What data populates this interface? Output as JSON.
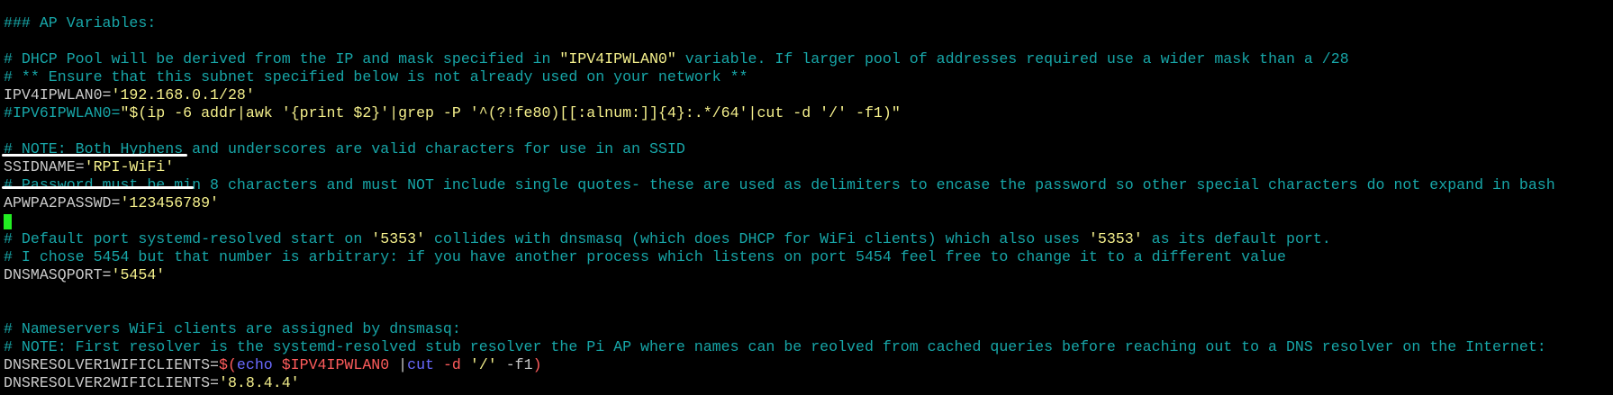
{
  "terminal": {
    "lines": [
      [
        {
          "t": "### AP Variables:",
          "c": "c"
        }
      ],
      [],
      [
        {
          "t": "# DHCP Pool will be derived from the IP and mask specified in ",
          "c": "c"
        },
        {
          "t": "\"IPV4IPWLAN0\"",
          "c": "y"
        },
        {
          "t": " variable. If larger pool of addresses required use a wider mask than a /28",
          "c": "c"
        }
      ],
      [
        {
          "t": "# ** Ensure that this subnet specified below is not already used on your network **",
          "c": "c"
        }
      ],
      [
        {
          "t": "IPV4IPWLAN0=",
          "c": "w"
        },
        {
          "t": "'192.168.0.1/28'",
          "c": "y"
        }
      ],
      [
        {
          "t": "#IPV6IPWLAN0=",
          "c": "c"
        },
        {
          "t": "\"$(ip -6 addr|awk '{print $2}'|grep -P '^(?!fe80)[[:alnum:]]{4}:.*/64'|cut -d '/' -f1)\"",
          "c": "y"
        }
      ],
      [],
      [
        {
          "t": "# NOTE: Both Hyphens and underscores are valid characters for use in an SSID",
          "c": "c"
        }
      ],
      [
        {
          "t": "SSIDNAME=",
          "c": "w"
        },
        {
          "t": "'RPI-WiFi'",
          "c": "y"
        }
      ],
      [
        {
          "t": "# Password must be min 8 characters and must NOT include single quotes- these are used as delimiters to encase the password so other special characters do not expand in bash",
          "c": "c"
        }
      ],
      [
        {
          "t": "APWPA2PASSWD=",
          "c": "w"
        },
        {
          "t": "'123456789'",
          "c": "y"
        }
      ],
      [],
      [
        {
          "t": "# Default port systemd-resolved start on ",
          "c": "c"
        },
        {
          "t": "'5353'",
          "c": "y"
        },
        {
          "t": " collides with dnsmasq (which does DHCP for WiFi clients) which also uses ",
          "c": "c"
        },
        {
          "t": "'5353'",
          "c": "y"
        },
        {
          "t": " as its default port.",
          "c": "c"
        }
      ],
      [
        {
          "t": "# I chose 5454 but that number is arbitrary: if you have another process which listens on port 5454 feel free to change it to a different value",
          "c": "c"
        }
      ],
      [
        {
          "t": "DNSMASQPORT=",
          "c": "w"
        },
        {
          "t": "'5454'",
          "c": "y"
        }
      ],
      [],
      [],
      [
        {
          "t": "# Nameservers WiFi clients are assigned by dnsmasq:",
          "c": "c"
        }
      ],
      [
        {
          "t": "# NOTE: First resolver is the systemd-resolved stub resolver the Pi AP where names can be reolved from cached queries before reaching out to a DNS resolver on the Internet:",
          "c": "c"
        }
      ],
      [
        {
          "t": "DNSRESOLVER1WIFICLIENTS=",
          "c": "w"
        },
        {
          "t": "$(",
          "c": "r"
        },
        {
          "t": "echo ",
          "c": "b"
        },
        {
          "t": "$IPV4IPWLAN0",
          "c": "r"
        },
        {
          "t": " |",
          "c": "w"
        },
        {
          "t": "cut",
          "c": "b"
        },
        {
          "t": " -d ",
          "c": "r"
        },
        {
          "t": "'/'",
          "c": "y"
        },
        {
          "t": " -f1",
          "c": "w"
        },
        {
          "t": ")",
          "c": "r"
        }
      ],
      [
        {
          "t": "DNSRESOLVER2WIFICLIENTS=",
          "c": "w"
        },
        {
          "t": "'8.8.4.4'",
          "c": "y"
        }
      ]
    ]
  },
  "colors": {
    "background": "#000000",
    "comment": "#17a6a8",
    "plain": "#c9c9c9",
    "string": "#f5f08c",
    "keyword": "#6a6aff",
    "variable": "#ff5c5c",
    "cursor": "#22ee22"
  }
}
